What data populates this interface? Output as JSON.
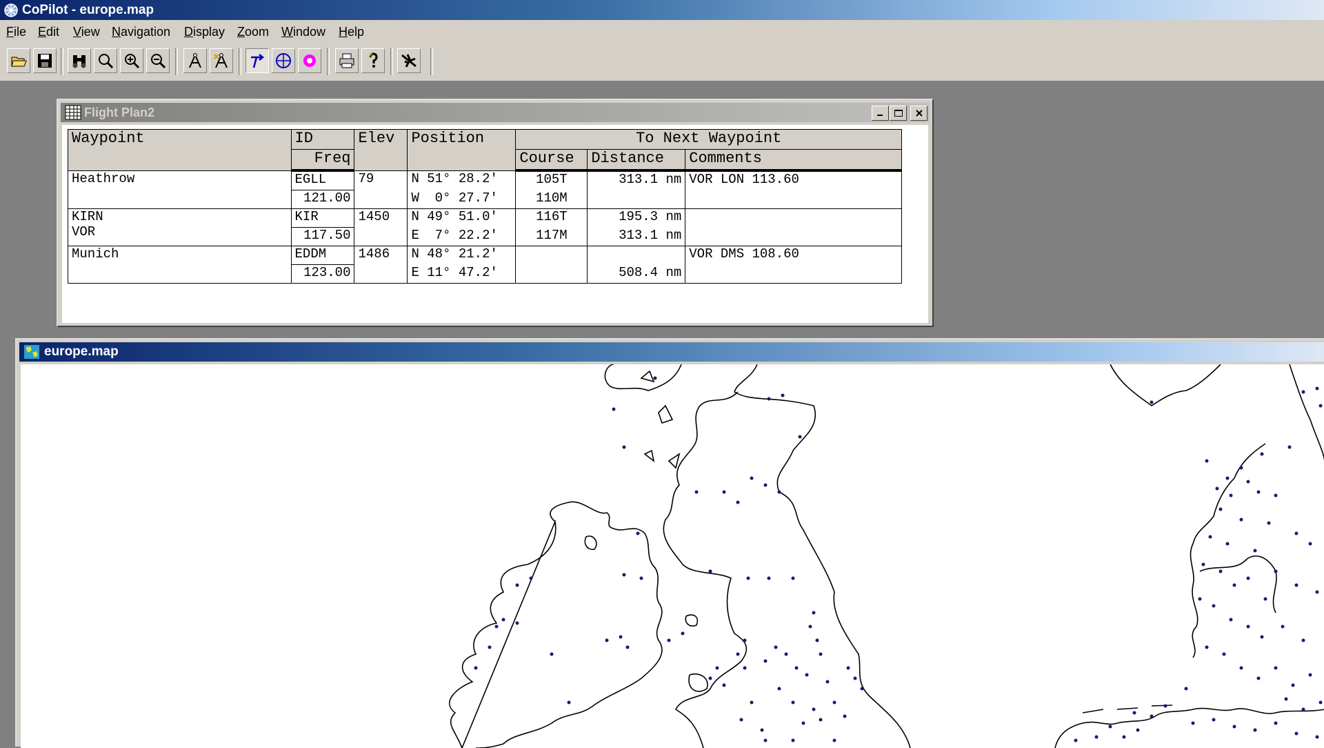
{
  "app": {
    "title": "CoPilot - europe.map"
  },
  "menu": [
    {
      "key": "F",
      "rest": "ile"
    },
    {
      "key": "E",
      "rest": "dit"
    },
    {
      "key": "V",
      "rest": "iew"
    },
    {
      "key": "N",
      "rest": "avigation"
    },
    {
      "key": "D",
      "rest": "isplay"
    },
    {
      "key": "Z",
      "rest": "oom"
    },
    {
      "key": "W",
      "rest": "indow"
    },
    {
      "key": "H",
      "rest": "elp"
    }
  ],
  "toolbar": [
    "open-folder-icon",
    "save-disk-icon",
    "binoculars-icon",
    "magnifier-icon",
    "zoom-in-icon",
    "zoom-out-icon",
    "compass-divider-icon",
    "compass-plus-icon",
    "route-arrow-icon",
    "compass-rose-icon",
    "target-circle-icon",
    "printer-icon",
    "help-icon",
    "airplane-icon"
  ],
  "flight_plan": {
    "title": "Flight Plan2",
    "headers": {
      "waypoint": "Waypoint",
      "id": "ID",
      "freq": "Freq",
      "elev": "Elev",
      "position": "Position",
      "to_next": "To Next Waypoint",
      "course": "Course",
      "distance": "Distance",
      "comments": "Comments"
    },
    "rows": [
      {
        "name1": "Heathrow",
        "name2": "",
        "id": "EGLL",
        "freq": "121.00",
        "elev": "79",
        "lat": "N 51° 28.2'",
        "lon": "W  0° 27.7'",
        "course_t": "105T",
        "course_m": "110M",
        "dist1": "313.1 nm",
        "dist2": "",
        "comment": "VOR LON 113.60"
      },
      {
        "name1": "KIRN",
        "name2": "VOR",
        "id": "KIR",
        "freq": "117.50",
        "elev": "1450",
        "lat": "N 49° 51.0'",
        "lon": "E  7° 22.2'",
        "course_t": "116T",
        "course_m": "117M",
        "dist1": "195.3 nm",
        "dist2": "313.1 nm",
        "comment": ""
      },
      {
        "name1": "Munich",
        "name2": "",
        "id": "EDDM",
        "freq": "123.00",
        "elev": "1486",
        "lat": "N 48° 21.2'",
        "lon": "E 11° 47.2'",
        "course_t": "",
        "course_m": "",
        "dist1": "",
        "dist2": "508.4 nm",
        "comment": "VOR DMS 108.60"
      }
    ]
  },
  "map_window": {
    "title": "europe.map"
  },
  "colors": {
    "airport_dot": "#1a1a6e",
    "coastline": "#000000",
    "title_active": "#0a246a"
  }
}
